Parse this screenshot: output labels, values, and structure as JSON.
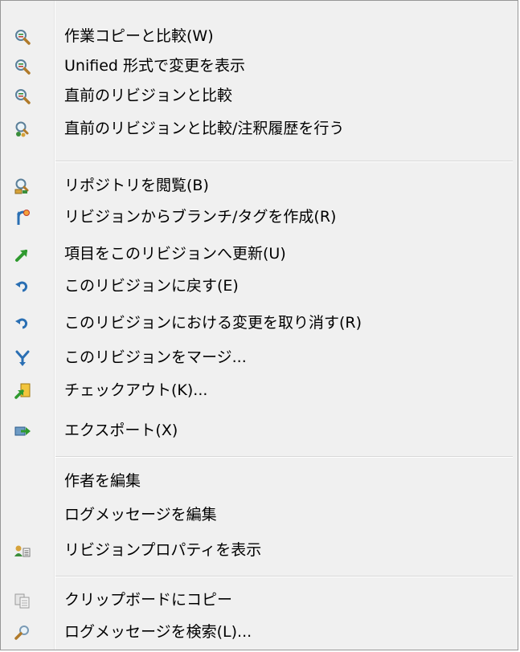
{
  "menu": {
    "items": [
      {
        "label": "作業コピーと比較(W)",
        "icon": "magnifier-diff-icon"
      },
      {
        "label": "Unified 形式で変更を表示",
        "icon": "magnifier-diff-icon"
      },
      {
        "label": "直前のリビジョンと比較",
        "icon": "magnifier-diff-icon"
      },
      {
        "label": "直前のリビジョンと比較/注釈履歴を行う",
        "icon": "magnifier-blame-icon"
      },
      {
        "label": "リポジトリを閲覧(B)",
        "icon": "repo-browser-icon"
      },
      {
        "label": "リビジョンからブランチ/タグを作成(R)",
        "icon": "branch-tag-icon"
      },
      {
        "label": "項目をこのリビジョンへ更新(U)",
        "icon": "update-arrow-icon"
      },
      {
        "label": "このリビジョンに戻す(E)",
        "icon": "revert-icon"
      },
      {
        "label": "このリビジョンにおける変更を取り消す(R)",
        "icon": "revert-icon"
      },
      {
        "label": "このリビジョンをマージ...",
        "icon": "merge-icon"
      },
      {
        "label": "チェックアウト(K)...",
        "icon": "checkout-icon"
      },
      {
        "label": "エクスポート(X)",
        "icon": "export-icon"
      },
      {
        "label": "作者を編集",
        "icon": ""
      },
      {
        "label": "ログメッセージを編集",
        "icon": ""
      },
      {
        "label": "リビジョンプロパティを表示",
        "icon": "properties-icon"
      },
      {
        "label": "クリップボードにコピー",
        "icon": "clipboard-copy-icon"
      },
      {
        "label": "ログメッセージを検索(L)...",
        "icon": "search-icon"
      }
    ]
  }
}
